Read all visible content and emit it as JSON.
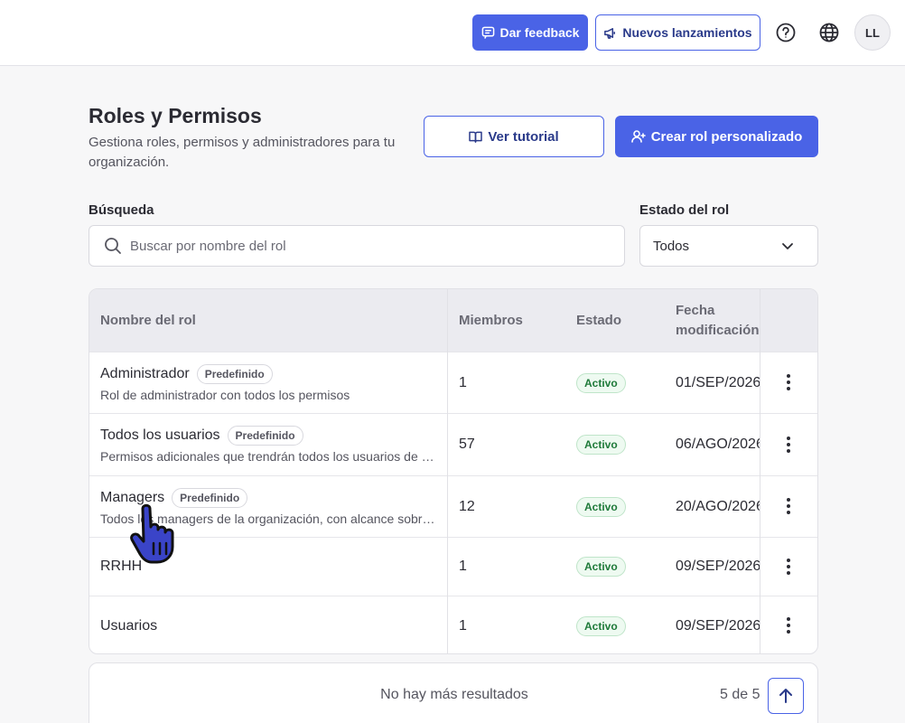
{
  "topbar": {
    "feedback_label": "Dar feedback",
    "launches_label": "Nuevos lanzamientos",
    "help_icon": "question-circle-icon",
    "language_icon": "globe-icon",
    "avatar_initials": "LL"
  },
  "header": {
    "title": "Roles y Permisos",
    "subtitle": "Gestiona roles, permisos y administradores para tu organización.",
    "tutorial_label": "Ver tutorial",
    "create_label": "Crear rol personalizado"
  },
  "filters": {
    "search_label": "Búsqueda",
    "search_placeholder": "Buscar por nombre del rol",
    "status_label": "Estado del rol",
    "status_value": "Todos"
  },
  "table": {
    "columns": [
      "Nombre del rol",
      "Miembros",
      "Estado",
      "Fecha modificación"
    ],
    "rows": [
      {
        "name": "Administrador",
        "badge": "Predefinido",
        "description": "Rol de administrador con todos los permisos",
        "members": "1",
        "status": "Activo",
        "date": "01/SEP/2026"
      },
      {
        "name": "Todos los usuarios",
        "badge": "Predefinido",
        "description": "Permisos adicionales que trendrán todos los usuarios de la organización",
        "members": "57",
        "status": "Activo",
        "date": "06/AGO/2026"
      },
      {
        "name": "Managers",
        "badge": "Predefinido",
        "description": "Todos los managers de la organización, con alcance sobre sus equipos",
        "members": "12",
        "status": "Activo",
        "date": "20/AGO/2026"
      },
      {
        "name": "RRHH",
        "badge": "",
        "description": "",
        "members": "1",
        "status": "Activo",
        "date": "09/SEP/2026"
      },
      {
        "name": "Usuarios",
        "badge": "",
        "description": "",
        "members": "1",
        "status": "Activo",
        "date": "09/SEP/2026"
      }
    ]
  },
  "footer": {
    "no_more_label": "No hay más resultados",
    "count_label": "5 de 5"
  },
  "colors": {
    "primary": "#4a63e6",
    "active_green": "#1f7a3a"
  }
}
